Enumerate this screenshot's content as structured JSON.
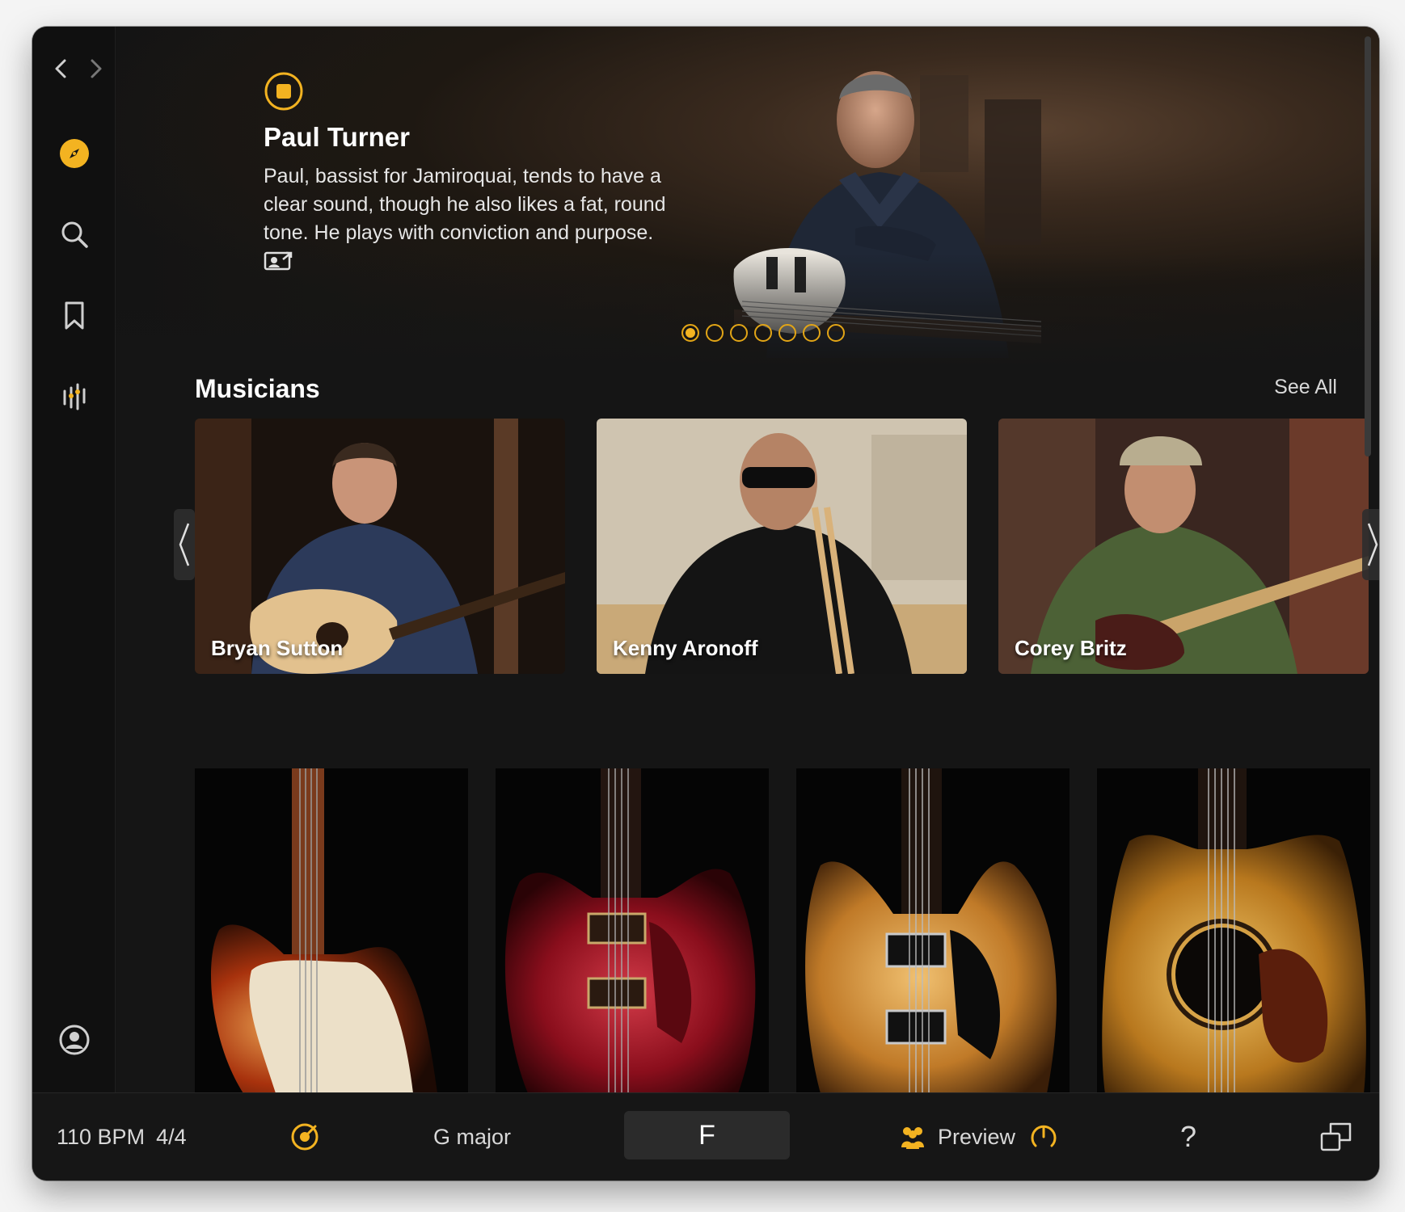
{
  "hero": {
    "name": "Paul Turner",
    "description": "Paul, bassist for Jamiroquai, tends to have a clear sound, though he also likes a fat, round tone. He plays with conviction and purpose.",
    "dots_total": 7,
    "dots_active": 1
  },
  "musicians": {
    "title": "Musicians",
    "see_all": "See All",
    "cards": [
      {
        "name": "Bryan Sutton"
      },
      {
        "name": "Kenny Aronoff"
      },
      {
        "name": "Corey Britz"
      }
    ]
  },
  "sidebar": {
    "icons": [
      "back-icon",
      "forward-icon",
      "compass-icon",
      "search-icon",
      "bookmark-icon",
      "levels-icon",
      "account-icon"
    ]
  },
  "bottom_bar": {
    "tempo": "110 BPM",
    "time_signature": "4/4",
    "key": "G major",
    "chord": "F",
    "preview": "Preview",
    "help": "?"
  },
  "colors": {
    "accent": "#f3b321",
    "background": "#151515"
  }
}
